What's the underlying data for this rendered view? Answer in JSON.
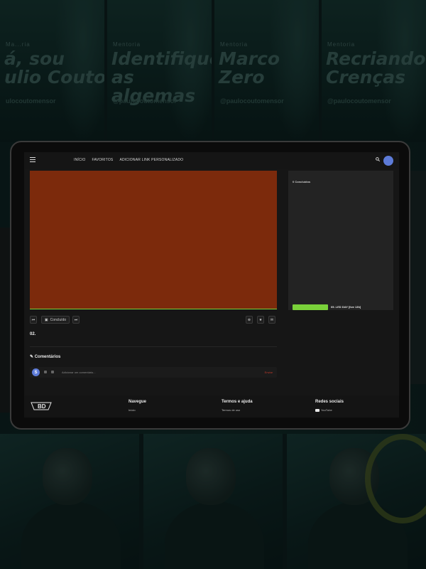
{
  "background": {
    "banners": [
      {
        "kicker": "Ma...ria",
        "title": "á, sou\nulio Couto",
        "handle": "ulocoutomensor"
      },
      {
        "kicker": "Mentoria",
        "title": "Identifique\nas algemas",
        "handle": "@paulocoutomensor"
      },
      {
        "kicker": "Mentoria",
        "title": "Marco\nZero",
        "handle": "@paulocoutomensor"
      },
      {
        "kicker": "Mentoria",
        "title": "Recriando\nCrenças",
        "handle": "@paulocoutomensor"
      }
    ]
  },
  "nav": {
    "menu_icon": "hamburger-icon",
    "links": [
      "INÍCIO",
      "FAVORITOS",
      "ADICIONAR LINK PERSONALIZADO"
    ],
    "search_icon": "search-icon"
  },
  "player": {
    "color": "#7c2a0c",
    "accent": "#7ad13a"
  },
  "toolbar": {
    "prev_icon": "skip-back-icon",
    "done_label": "Concluído",
    "next_icon": "skip-forward-icon"
  },
  "lesson": {
    "title": "02."
  },
  "comments": {
    "heading": "Comentários",
    "avatar_letter": "S",
    "placeholder": "Adicionar um comentário...",
    "send_label": "Enviar"
  },
  "sidebar": {
    "label": "0 Concluídos",
    "item_title": "05. LED DAY [live 13h]"
  },
  "footer": {
    "logo_text": "BD",
    "columns": [
      {
        "heading": "Navegue",
        "links": [
          "Início"
        ]
      },
      {
        "heading": "Termos e ajuda",
        "links": [
          "Termos de uso"
        ]
      },
      {
        "heading": "Redes sociais",
        "links": [
          "YouTube"
        ]
      }
    ]
  }
}
